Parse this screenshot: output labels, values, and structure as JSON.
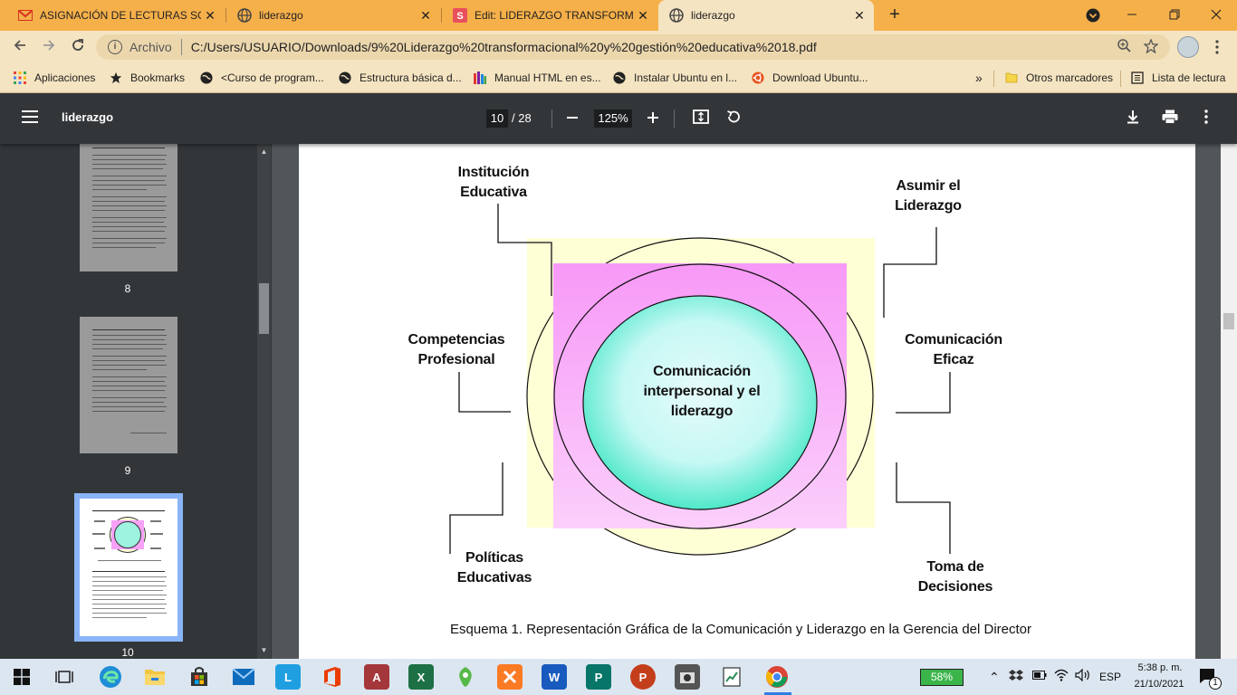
{
  "browser": {
    "tabs": [
      {
        "title": "ASIGNACIÓN DE LECTURAS SOBRE",
        "icon": "gmail-icon",
        "active": false
      },
      {
        "title": "liderazgo",
        "icon": "globe-icon",
        "active": false
      },
      {
        "title": "Edit: LIDERAZGO TRANSFORMACIONAL",
        "icon": "slides-icon",
        "active": false
      },
      {
        "title": "liderazgo",
        "icon": "globe-icon",
        "active": true
      }
    ],
    "close_glyph": "✕",
    "new_tab_glyph": "+",
    "address": {
      "scheme_label": "Archivo",
      "url": "C:/Users/USUARIO/Downloads/9%20Liderazgo%20transformacional%20y%20gestión%20educativa%2018.pdf"
    },
    "bookmarks": [
      {
        "label": "Aplicaciones",
        "icon": "apps-grid-icon"
      },
      {
        "label": "Bookmarks",
        "icon": "star-icon"
      },
      {
        "label": "<Curso de program...",
        "icon": "globe-icon"
      },
      {
        "label": "Estructura básica d...",
        "icon": "globe-icon"
      },
      {
        "label": "Manual HTML en es...",
        "icon": "bars-icon"
      },
      {
        "label": "Instalar Ubuntu en l...",
        "icon": "globe-icon"
      },
      {
        "label": "Download Ubuntu...",
        "icon": "ubuntu-icon"
      }
    ],
    "bookmarks_overflow": "»",
    "other_bookmarks": "Otros marcadores",
    "reading_list": "Lista de lectura"
  },
  "pdf": {
    "title": "liderazgo",
    "current_page": "10",
    "total_pages": "/ 28",
    "zoom": "125%",
    "thumbnails": [
      {
        "page": "8"
      },
      {
        "page": "9"
      },
      {
        "page": "10",
        "selected": true
      }
    ]
  },
  "diagram": {
    "center": "Comunicación interpersonal y el liderazgo",
    "labels": {
      "institucion": "Institución Educativa",
      "asumir": "Asumir el Liderazgo",
      "competencias": "Competencias Profesional",
      "comunicacion": "Comunicación Eficaz",
      "politicas": "Políticas Educativas",
      "toma": "Toma de Decisiones"
    },
    "caption": "Esquema 1. Representación Gráfica de la Comunicación y Liderazgo en la Gerencia del Director",
    "colors": {
      "outer_square": "#ffffd6",
      "inner_square": "#f7a1f7",
      "center_gradient_a": "#d5fbfb",
      "center_gradient_b": "#4fe8c9"
    }
  },
  "taskbar": {
    "battery": "58%",
    "language": "ESP",
    "time": "5:38 p. m.",
    "date": "21/10/2021",
    "notifications": "1",
    "apps": [
      "start-icon",
      "task-view-icon",
      "edge-icon",
      "file-explorer-icon",
      "store-icon",
      "mail-icon",
      "l-app-icon",
      "office-icon",
      "access-icon",
      "excel-icon",
      "app-green-icon",
      "xampp-icon",
      "word-icon",
      "publisher-icon",
      "powerpoint-icon",
      "camera-app-icon",
      "project-app-icon",
      "chrome-icon"
    ]
  }
}
